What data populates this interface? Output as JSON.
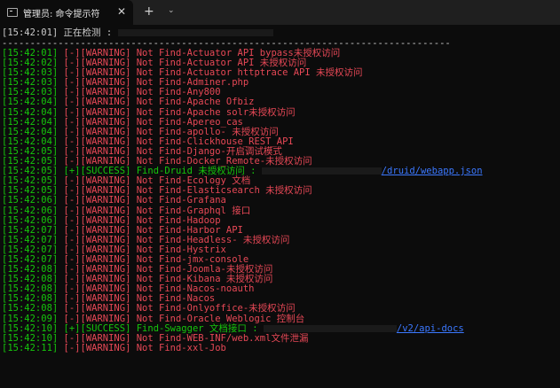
{
  "window": {
    "tab_title": "管理员: 命令提示符",
    "close_glyph": "✕",
    "new_tab_glyph": "+",
    "dropdown_glyph": "⌄"
  },
  "header": {
    "timestamp": "[15:42:01]",
    "text": " 正在检测 : ",
    "separator": "--------------------------------------------------------------------------------"
  },
  "lines": [
    {
      "ts": "[15:42:01]",
      "tag": " [-][WARNING]",
      "msg": " Not Find-Actuator API bypass未授权访问",
      "type": "warn"
    },
    {
      "ts": "[15:42:02]",
      "tag": " [-][WARNING]",
      "msg": " Not Find-Actuator API 未授权访问",
      "type": "warn"
    },
    {
      "ts": "[15:42:03]",
      "tag": " [-][WARNING]",
      "msg": " Not Find-Actuator httptrace API 未授权访问",
      "type": "warn"
    },
    {
      "ts": "[15:42:03]",
      "tag": " [-][WARNING]",
      "msg": " Not Find-Adminer.php",
      "type": "warn"
    },
    {
      "ts": "[15:42:03]",
      "tag": " [-][WARNING]",
      "msg": " Not Find-Any800",
      "type": "warn"
    },
    {
      "ts": "[15:42:04]",
      "tag": " [-][WARNING]",
      "msg": " Not Find-Apache Ofbiz",
      "type": "warn"
    },
    {
      "ts": "[15:42:04]",
      "tag": " [-][WARNING]",
      "msg": " Not Find-Apache solr未授权访问",
      "type": "warn"
    },
    {
      "ts": "[15:42:04]",
      "tag": " [-][WARNING]",
      "msg": " Not Find-Apereo_cas",
      "type": "warn"
    },
    {
      "ts": "[15:42:04]",
      "tag": " [-][WARNING]",
      "msg": " Not Find-apollo- 未授权访问",
      "type": "warn"
    },
    {
      "ts": "[15:42:04]",
      "tag": " [-][WARNING]",
      "msg": " Not Find-Clickhouse_REST_API",
      "type": "warn"
    },
    {
      "ts": "[15:42:05]",
      "tag": " [-][WARNING]",
      "msg": " Not Find-Django-开启调试模式",
      "type": "warn"
    },
    {
      "ts": "[15:42:05]",
      "tag": " [-][WARNING]",
      "msg": " Not Find-Docker_Remote-未授权访问",
      "type": "warn"
    },
    {
      "ts": "[15:42:05]",
      "tag": " [+][SUCCESS]",
      "msg": " Find-Druid 未授权访问 : ",
      "type": "ok",
      "url_tail": "/druid/webapp.json"
    },
    {
      "ts": "[15:42:05]",
      "tag": " [-][WARNING]",
      "msg": " Not Find-Ecology 文档",
      "type": "warn"
    },
    {
      "ts": "[15:42:05]",
      "tag": " [-][WARNING]",
      "msg": " Not Find-Elasticsearch 未授权访问",
      "type": "warn"
    },
    {
      "ts": "[15:42:06]",
      "tag": " [-][WARNING]",
      "msg": " Not Find-Grafana",
      "type": "warn"
    },
    {
      "ts": "[15:42:06]",
      "tag": " [-][WARNING]",
      "msg": " Not Find-Graphql 接口",
      "type": "warn"
    },
    {
      "ts": "[15:42:06]",
      "tag": " [-][WARNING]",
      "msg": " Not Find-Hadoop",
      "type": "warn"
    },
    {
      "ts": "[15:42:07]",
      "tag": " [-][WARNING]",
      "msg": " Not Find-Harbor API",
      "type": "warn"
    },
    {
      "ts": "[15:42:07]",
      "tag": " [-][WARNING]",
      "msg": " Not Find-Headless- 未授权访问",
      "type": "warn"
    },
    {
      "ts": "[15:42:07]",
      "tag": " [-][WARNING]",
      "msg": " Not Find-Hystrix",
      "type": "warn"
    },
    {
      "ts": "[15:42:07]",
      "tag": " [-][WARNING]",
      "msg": " Not Find-jmx-console",
      "type": "warn"
    },
    {
      "ts": "[15:42:08]",
      "tag": " [-][WARNING]",
      "msg": " Not Find-Joomla-未授权访问",
      "type": "warn"
    },
    {
      "ts": "[15:42:08]",
      "tag": " [-][WARNING]",
      "msg": " Not Find-Kibana 未授权访问",
      "type": "warn"
    },
    {
      "ts": "[15:42:08]",
      "tag": " [-][WARNING]",
      "msg": " Not Find-Nacos-noauth",
      "type": "warn"
    },
    {
      "ts": "[15:42:08]",
      "tag": " [-][WARNING]",
      "msg": " Not Find-Nacos",
      "type": "warn"
    },
    {
      "ts": "[15:42:08]",
      "tag": " [-][WARNING]",
      "msg": " Not Find-Onlyoffice-未授权访问",
      "type": "warn"
    },
    {
      "ts": "[15:42:09]",
      "tag": " [-][WARNING]",
      "msg": " Not Find-Oracle Weblogic 控制台",
      "type": "warn"
    },
    {
      "ts": "[15:42:10]",
      "tag": " [+][SUCCESS]",
      "msg": " Find-Swagger 文档接口 : ",
      "type": "ok",
      "url_tail": "/v2/api-docs"
    },
    {
      "ts": "[15:42:10]",
      "tag": " [-][WARNING]",
      "msg": " Not Find-WEB-INF/web.xml文件泄漏",
      "type": "warn"
    },
    {
      "ts": "[15:42:11]",
      "tag": " [-][WARNING]",
      "msg": " Not Find-xxl-Job",
      "type": "warn"
    }
  ]
}
